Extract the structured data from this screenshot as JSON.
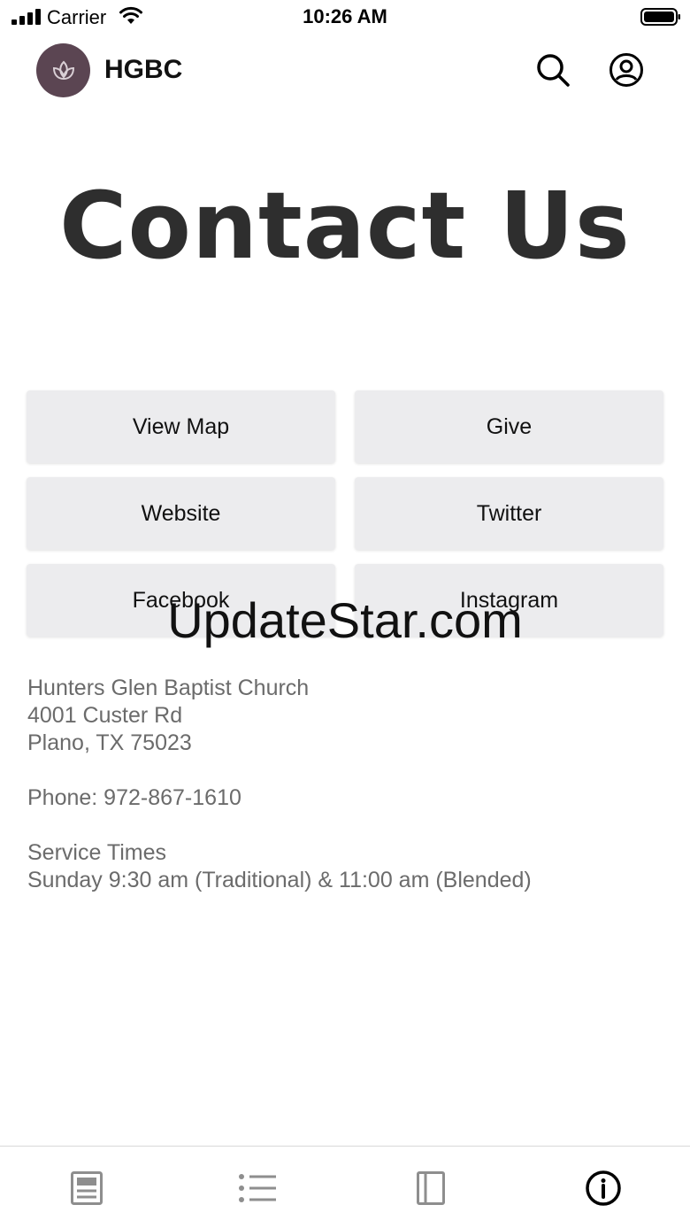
{
  "status_bar": {
    "carrier": "Carrier",
    "time": "10:26 AM"
  },
  "header": {
    "title": "HGBC",
    "logo_color": "#5b4552",
    "icons": [
      "leaf-logo-icon",
      "search-icon",
      "account-icon"
    ]
  },
  "banner": {
    "text": "Contact Us"
  },
  "buttons": [
    {
      "label": "View Map"
    },
    {
      "label": "Give"
    },
    {
      "label": "Website"
    },
    {
      "label": "Twitter"
    },
    {
      "label": "Facebook"
    },
    {
      "label": "Instagram"
    }
  ],
  "info": {
    "church_name": "Hunters Glen Baptist Church",
    "street": "4001 Custer Rd",
    "city": "Plano, TX 75023",
    "phone": "Phone: 972-867-1610",
    "service_heading": "Service Times",
    "service_times": "Sunday 9:30 am (Traditional) & 11:00 am (Blended)"
  },
  "watermark": "UpdateStar.com",
  "tab_bar": {
    "icons": [
      "news-icon",
      "list-icon",
      "book-icon",
      "info-icon"
    ],
    "active_color": "#000000",
    "inactive_color": "#8e8e8e"
  }
}
